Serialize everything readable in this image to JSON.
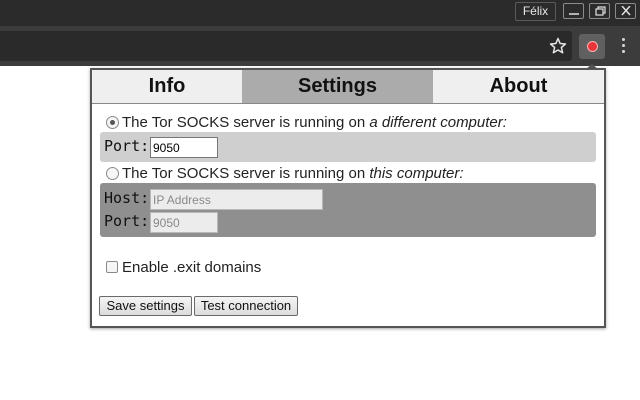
{
  "browser": {
    "profile_name": "Félix",
    "window_buttons": [
      "minimize-icon",
      "restore-icon",
      "close-icon"
    ],
    "bookmark_icon": "star-icon",
    "extension_icon": "tor-onion-icon",
    "menu_icon": "kebab-menu-icon"
  },
  "popup": {
    "tabs": [
      {
        "label": "Info",
        "selected": false
      },
      {
        "label": "Settings",
        "selected": true
      },
      {
        "label": "About",
        "selected": false
      }
    ],
    "option_remote": {
      "prefix": "The Tor SOCKS server is running on ",
      "emphasis": "a different computer:",
      "checked": true,
      "port_label": "Port:",
      "port_value": "9050"
    },
    "option_local": {
      "prefix": "The Tor SOCKS server is running on ",
      "emphasis": "this computer:",
      "checked": false,
      "host_label": "Host:",
      "host_placeholder": "IP Address",
      "port_label": "Port:",
      "port_value": "9050"
    },
    "exit_domains": {
      "label": "Enable .exit domains",
      "checked": false
    },
    "buttons": {
      "save": "Save settings",
      "test": "Test connection"
    }
  },
  "colors": {
    "chrome_dark": "#2b2b2b",
    "toolbar": "#3c3c3c",
    "tab_selected": "#ababab",
    "panel_remote": "#cfcfcf",
    "panel_local": "#8f8f8f",
    "extension_red": "#e8353c"
  }
}
